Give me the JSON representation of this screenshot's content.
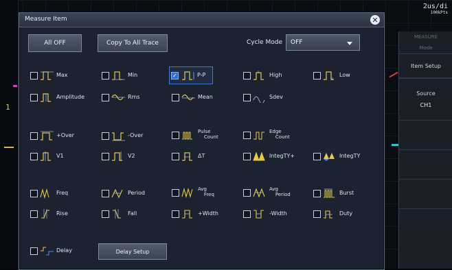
{
  "header": {
    "timebase": "2us/di",
    "samplerate": "100kPts"
  },
  "dialog": {
    "title": "Measure Item",
    "close_symbol": "✕"
  },
  "toolbar": {
    "all_off_label": "All OFF",
    "copy_label": "Copy To All Trace",
    "cycle_mode_label": "Cycle Mode",
    "cycle_mode_value": "OFF"
  },
  "items": {
    "max": "Max",
    "min": "Min",
    "pp": "P-P",
    "high": "High",
    "low": "Low",
    "amplitude": "Amplitude",
    "rms": "Rms",
    "mean": "Mean",
    "sdev": "Sdev",
    "plus_over": "+Over",
    "minus_over": "-Over",
    "pulse_count_1": "Pulse",
    "pulse_count_2": "Count",
    "edge_count_1": "Edge",
    "edge_count_2": "Count",
    "v1": "V1",
    "v2": "V2",
    "dt": "ΔT",
    "integty_plus": "IntegTY+",
    "integty": "IntegTY",
    "freq": "Freq",
    "period": "Period",
    "avg_freq_1": "Avg",
    "avg_freq_2": "Freq",
    "avg_period_1": "Avg",
    "avg_period_2": "Period",
    "burst": "Burst",
    "rise": "Rise",
    "fall": "Fall",
    "plus_width": "+Width",
    "minus_width": "-Width",
    "duty": "Duty",
    "delay": "Delay"
  },
  "delay_setup_label": "Delay Setup",
  "side_panel": {
    "header": "MEASURE",
    "mode": "Mode",
    "item_setup": "Item Setup",
    "source_label": "Source",
    "source_value": "CH1"
  },
  "markers": {
    "ch1": "1"
  },
  "colors": {
    "accent": "#2f6fd0",
    "dialog_bg": "#1c2230",
    "border": "#5d6c82"
  }
}
